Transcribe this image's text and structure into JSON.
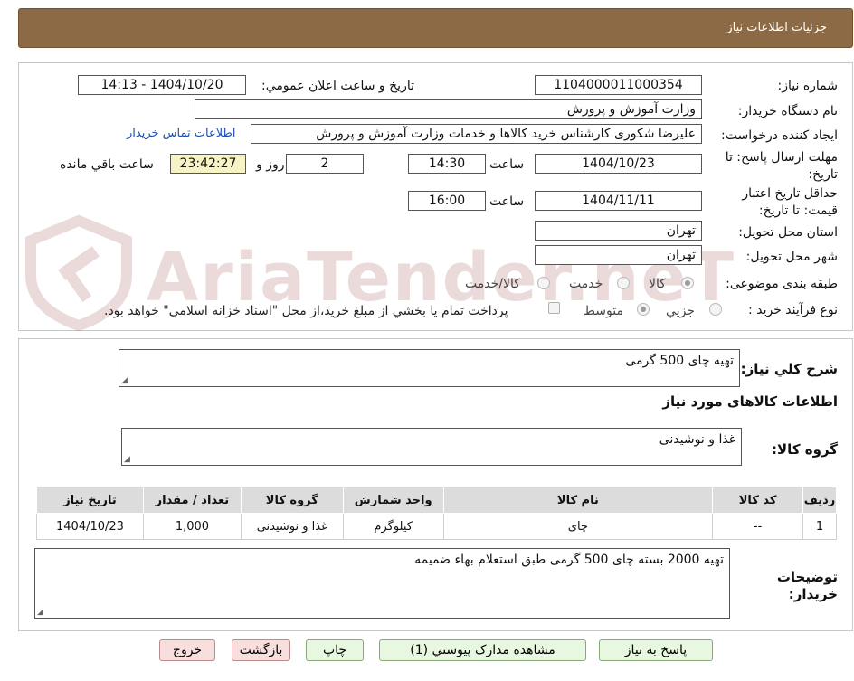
{
  "header": {
    "title": "جزئیات اطلاعات نیاز"
  },
  "watermark": {
    "brand": "AriaTender.neT"
  },
  "form": {
    "need_number_label": "شماره نیاز:",
    "need_number": "1104000011000354",
    "announce_label": "تاریخ و ساعت اعلان عمومي:",
    "announce_value": "1404/10/20 - 14:13",
    "buyer_org_label": "نام دستگاه خريدار:",
    "buyer_org": "وزارت آموزش و پرورش",
    "requester_label": "ایجاد کننده درخواست:",
    "requester": "علیرضا شکوری کارشناس خرید کالاها و خدمات وزارت آموزش و پرورش",
    "buyer_contact_link": "اطلاعات تماس خريدار",
    "deadline_label": "مهلت ارسال پاسخ: تا تاريخ:",
    "deadline_date": "1404/10/23",
    "time_label": "ساعت",
    "deadline_time": "14:30",
    "days_count": "2",
    "days_label": "روز و",
    "remaining_time": "23:42:27",
    "remaining_label": "ساعت باقي مانده",
    "validity_label": "حداقل تاريخ اعتبار قيمت: تا تاريخ:",
    "validity_date": "1404/11/11",
    "validity_time": "16:00",
    "province_label": "استان محل تحويل:",
    "province": "تهران",
    "city_label": "شهر محل تحويل:",
    "city": "تهران",
    "category_label": "طبقه بندی موضوعی:",
    "category_options": [
      "کالا",
      "خدمت",
      "کالا/خدمت"
    ],
    "process_label": "نوع فرآيند خريد :",
    "process_options": [
      "جزيي",
      "متوسط"
    ],
    "payment_note": "پرداخت تمام يا بخشي از مبلغ خريد،از محل \"اسناد خزانه اسلامی\" خواهد بود."
  },
  "summary": {
    "label": "شرح كلي نياز:",
    "value": "تهیه چای 500 گرمی"
  },
  "goods_section": {
    "title": "اطلاعات کالاهای مورد نياز"
  },
  "goods_group": {
    "label": "گروه کالا:",
    "value": "غذا و نوشیدنی"
  },
  "table": {
    "headers": [
      "رديف",
      "کد کالا",
      "نام کالا",
      "واحد شمارش",
      "گروه کالا",
      "تعداد / مقدار",
      "تاريخ نياز"
    ],
    "rows": [
      [
        "1",
        "--",
        "چای",
        "کیلوگرم",
        "غذا و نوشیدنی",
        "1,000",
        "1404/10/23"
      ]
    ]
  },
  "buyer_notes": {
    "label": "توضيحات خريدار:",
    "value": "تهیه 2000 بسته چای 500 گرمی طبق استعلام بهاء ضمیمه"
  },
  "buttons": {
    "reply": "پاسخ به نياز",
    "attachments": "مشاهده مدارک پيوستي (1)",
    "print": "چاپ",
    "back": "بازگشت",
    "exit": "خروج"
  },
  "colors": {
    "header_bg": "#8b6a45",
    "link": "#1a4fb8",
    "green_btn": "#e8f7e0",
    "pink_btn": "#f9dede"
  }
}
